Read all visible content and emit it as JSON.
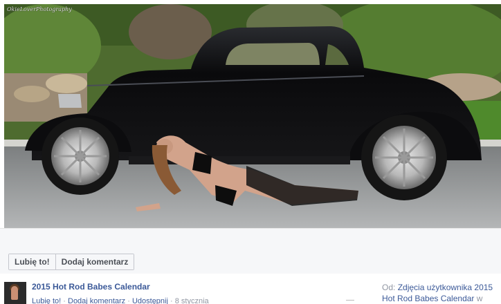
{
  "photo": {
    "watermark": "OkieLoverPhotography"
  },
  "actions": {
    "like_label": "Lubię to!",
    "comment_label": "Dodaj komentarz"
  },
  "post": {
    "title": "2015 Hot Rod Babes Calendar",
    "meta_like": "Lubię to!",
    "meta_comment": "Dodaj komentarz",
    "meta_share": "Udostępnij",
    "date": "8 stycznia",
    "separator": "·"
  },
  "source": {
    "from_label": "Od:",
    "album_text": "Zdjęcia użytkownika 2015 Hot Rod Babes Calendar",
    "suffix": "w"
  },
  "colors": {
    "link": "#3b5998",
    "muted": "#9197a3",
    "bar": "#f6f7f9",
    "car": "#0b0b0d"
  }
}
